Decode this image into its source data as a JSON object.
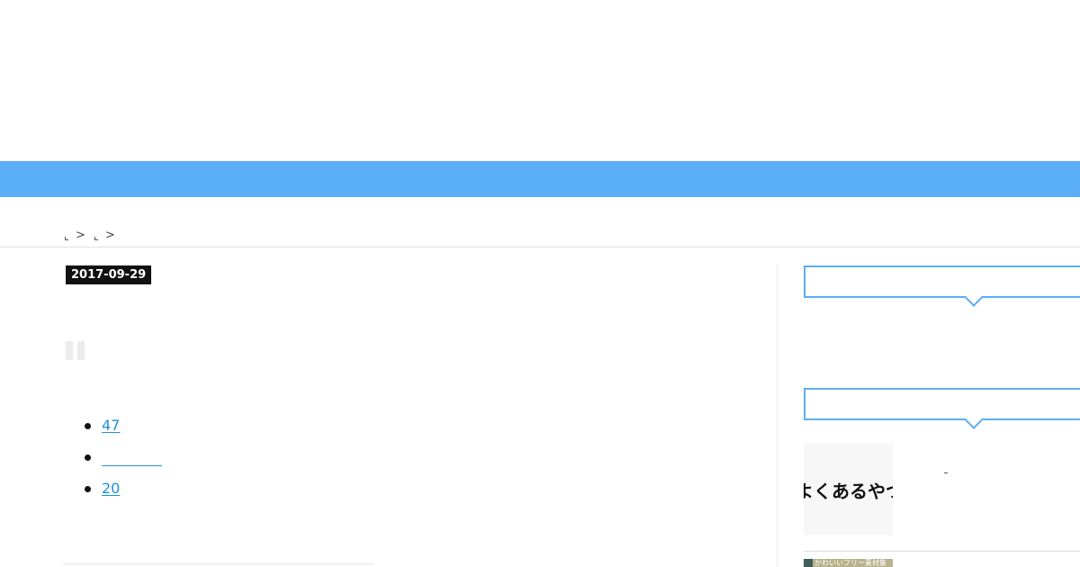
{
  "colors": {
    "nav_bar": "#5aaef5",
    "link": "#1e90d6",
    "date_badge_bg": "#111111",
    "widget_border": "#5aaef5"
  },
  "breadcrumb": {
    "separator": ">"
  },
  "article": {
    "date": "2017-09-29",
    "links": [
      {
        "label": "47"
      },
      {
        "label": ""
      },
      {
        "label": "20"
      }
    ]
  },
  "sidebar": {
    "widget_1_heading": "",
    "widget_2_heading": "",
    "thumb_1_text": "よくあるやつ",
    "thumb_2_text": "かわいいフリー素材集"
  }
}
